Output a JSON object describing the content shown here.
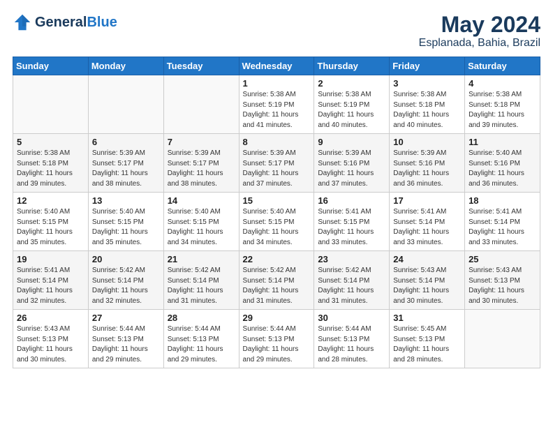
{
  "header": {
    "logo_line1": "General",
    "logo_line2": "Blue",
    "month": "May 2024",
    "location": "Esplanada, Bahia, Brazil"
  },
  "days_of_week": [
    "Sunday",
    "Monday",
    "Tuesday",
    "Wednesday",
    "Thursday",
    "Friday",
    "Saturday"
  ],
  "weeks": [
    [
      {
        "day": "",
        "info": ""
      },
      {
        "day": "",
        "info": ""
      },
      {
        "day": "",
        "info": ""
      },
      {
        "day": "1",
        "info": "Sunrise: 5:38 AM\nSunset: 5:19 PM\nDaylight: 11 hours\nand 41 minutes."
      },
      {
        "day": "2",
        "info": "Sunrise: 5:38 AM\nSunset: 5:19 PM\nDaylight: 11 hours\nand 40 minutes."
      },
      {
        "day": "3",
        "info": "Sunrise: 5:38 AM\nSunset: 5:18 PM\nDaylight: 11 hours\nand 40 minutes."
      },
      {
        "day": "4",
        "info": "Sunrise: 5:38 AM\nSunset: 5:18 PM\nDaylight: 11 hours\nand 39 minutes."
      }
    ],
    [
      {
        "day": "5",
        "info": "Sunrise: 5:38 AM\nSunset: 5:18 PM\nDaylight: 11 hours\nand 39 minutes."
      },
      {
        "day": "6",
        "info": "Sunrise: 5:39 AM\nSunset: 5:17 PM\nDaylight: 11 hours\nand 38 minutes."
      },
      {
        "day": "7",
        "info": "Sunrise: 5:39 AM\nSunset: 5:17 PM\nDaylight: 11 hours\nand 38 minutes."
      },
      {
        "day": "8",
        "info": "Sunrise: 5:39 AM\nSunset: 5:17 PM\nDaylight: 11 hours\nand 37 minutes."
      },
      {
        "day": "9",
        "info": "Sunrise: 5:39 AM\nSunset: 5:16 PM\nDaylight: 11 hours\nand 37 minutes."
      },
      {
        "day": "10",
        "info": "Sunrise: 5:39 AM\nSunset: 5:16 PM\nDaylight: 11 hours\nand 36 minutes."
      },
      {
        "day": "11",
        "info": "Sunrise: 5:40 AM\nSunset: 5:16 PM\nDaylight: 11 hours\nand 36 minutes."
      }
    ],
    [
      {
        "day": "12",
        "info": "Sunrise: 5:40 AM\nSunset: 5:15 PM\nDaylight: 11 hours\nand 35 minutes."
      },
      {
        "day": "13",
        "info": "Sunrise: 5:40 AM\nSunset: 5:15 PM\nDaylight: 11 hours\nand 35 minutes."
      },
      {
        "day": "14",
        "info": "Sunrise: 5:40 AM\nSunset: 5:15 PM\nDaylight: 11 hours\nand 34 minutes."
      },
      {
        "day": "15",
        "info": "Sunrise: 5:40 AM\nSunset: 5:15 PM\nDaylight: 11 hours\nand 34 minutes."
      },
      {
        "day": "16",
        "info": "Sunrise: 5:41 AM\nSunset: 5:15 PM\nDaylight: 11 hours\nand 33 minutes."
      },
      {
        "day": "17",
        "info": "Sunrise: 5:41 AM\nSunset: 5:14 PM\nDaylight: 11 hours\nand 33 minutes."
      },
      {
        "day": "18",
        "info": "Sunrise: 5:41 AM\nSunset: 5:14 PM\nDaylight: 11 hours\nand 33 minutes."
      }
    ],
    [
      {
        "day": "19",
        "info": "Sunrise: 5:41 AM\nSunset: 5:14 PM\nDaylight: 11 hours\nand 32 minutes."
      },
      {
        "day": "20",
        "info": "Sunrise: 5:42 AM\nSunset: 5:14 PM\nDaylight: 11 hours\nand 32 minutes."
      },
      {
        "day": "21",
        "info": "Sunrise: 5:42 AM\nSunset: 5:14 PM\nDaylight: 11 hours\nand 31 minutes."
      },
      {
        "day": "22",
        "info": "Sunrise: 5:42 AM\nSunset: 5:14 PM\nDaylight: 11 hours\nand 31 minutes."
      },
      {
        "day": "23",
        "info": "Sunrise: 5:42 AM\nSunset: 5:14 PM\nDaylight: 11 hours\nand 31 minutes."
      },
      {
        "day": "24",
        "info": "Sunrise: 5:43 AM\nSunset: 5:14 PM\nDaylight: 11 hours\nand 30 minutes."
      },
      {
        "day": "25",
        "info": "Sunrise: 5:43 AM\nSunset: 5:13 PM\nDaylight: 11 hours\nand 30 minutes."
      }
    ],
    [
      {
        "day": "26",
        "info": "Sunrise: 5:43 AM\nSunset: 5:13 PM\nDaylight: 11 hours\nand 30 minutes."
      },
      {
        "day": "27",
        "info": "Sunrise: 5:44 AM\nSunset: 5:13 PM\nDaylight: 11 hours\nand 29 minutes."
      },
      {
        "day": "28",
        "info": "Sunrise: 5:44 AM\nSunset: 5:13 PM\nDaylight: 11 hours\nand 29 minutes."
      },
      {
        "day": "29",
        "info": "Sunrise: 5:44 AM\nSunset: 5:13 PM\nDaylight: 11 hours\nand 29 minutes."
      },
      {
        "day": "30",
        "info": "Sunrise: 5:44 AM\nSunset: 5:13 PM\nDaylight: 11 hours\nand 28 minutes."
      },
      {
        "day": "31",
        "info": "Sunrise: 5:45 AM\nSunset: 5:13 PM\nDaylight: 11 hours\nand 28 minutes."
      },
      {
        "day": "",
        "info": ""
      }
    ]
  ]
}
